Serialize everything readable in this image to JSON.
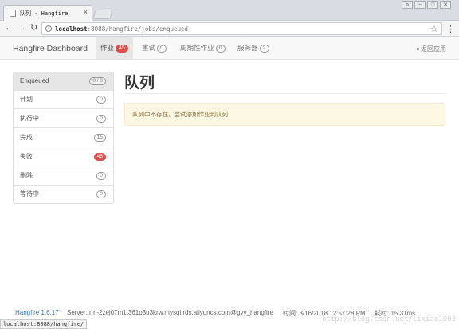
{
  "browser": {
    "tab_title": "队列 - Hangfire",
    "tab_close": "×",
    "url_host": "localhost",
    "url_path": ":8088/hangfire/jobs/enqueued",
    "star": "☆",
    "menu": "⋮",
    "status_url": "localhost:8088/hangfire/",
    "win_user": "⍝",
    "win_min": "−",
    "win_max": "□",
    "win_close": "✕"
  },
  "navbar": {
    "brand": "Hangfire Dashboard",
    "items": [
      {
        "label": "作业",
        "count": "45"
      },
      {
        "label": "重试",
        "count": "0"
      },
      {
        "label": "周期性作业",
        "count": "0"
      },
      {
        "label": "服务器",
        "count": "2"
      }
    ],
    "back_label": "返回应用"
  },
  "sidebar": {
    "items": [
      {
        "label": "Enqueued",
        "count": "0 / 0"
      },
      {
        "label": "计划",
        "count": "0"
      },
      {
        "label": "执行中",
        "count": "0"
      },
      {
        "label": "完成",
        "count": "15"
      },
      {
        "label": "失败",
        "count": "45"
      },
      {
        "label": "删除",
        "count": "0"
      },
      {
        "label": "等待中",
        "count": "0"
      }
    ]
  },
  "main": {
    "title": "队列",
    "alert": "队列中不存在。尝试添加作业到队列"
  },
  "footer": {
    "version": "Hangfire 1.6.17",
    "server": "Server: rm-2zej07m1t361p3u3krw.mysql.rds.aliyuncs.com@gyy_hangfire",
    "time": "时间: 3/16/2018 12:57:28 PM",
    "elapsed": "耗时: 15.31ms"
  },
  "watermark": "http://blog.csdn.net/lixiao1003",
  "colors": {
    "badge_red": "#d9534f",
    "alert_bg": "#fcf8e3",
    "alert_text": "#8a6d3b",
    "link_blue": "#337ab7"
  }
}
